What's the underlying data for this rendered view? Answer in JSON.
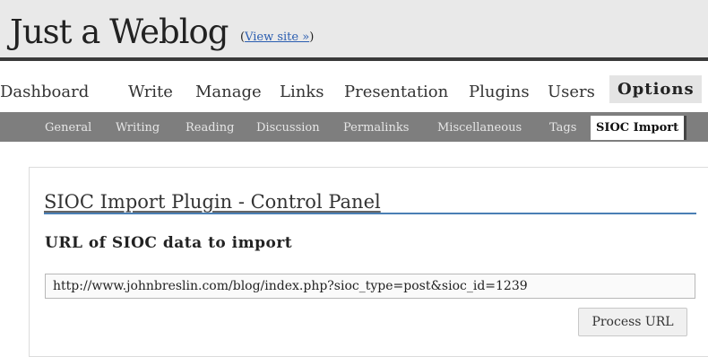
{
  "header": {
    "site_title": "Just a Weblog",
    "view_site_open": "(",
    "view_site_label": "View site »",
    "view_site_close": ")"
  },
  "main_nav": {
    "items": [
      "Dashboard",
      "Write",
      "Manage",
      "Links",
      "Presentation",
      "Plugins",
      "Users",
      "Options"
    ],
    "active": "Options"
  },
  "sub_nav": {
    "items": [
      "General",
      "Writing",
      "Reading",
      "Discussion",
      "Permalinks",
      "Miscellaneous",
      "Tags",
      "SIOC Import"
    ],
    "active": "SIOC Import"
  },
  "panel": {
    "title": "SIOC Import Plugin - Control Panel",
    "section_heading": "URL of SIOC data to import",
    "url_value": "http://www.johnbreslin.com/blog/index.php?sioc_type=post&sioc_id=1239",
    "button_label": "Process URL"
  }
}
